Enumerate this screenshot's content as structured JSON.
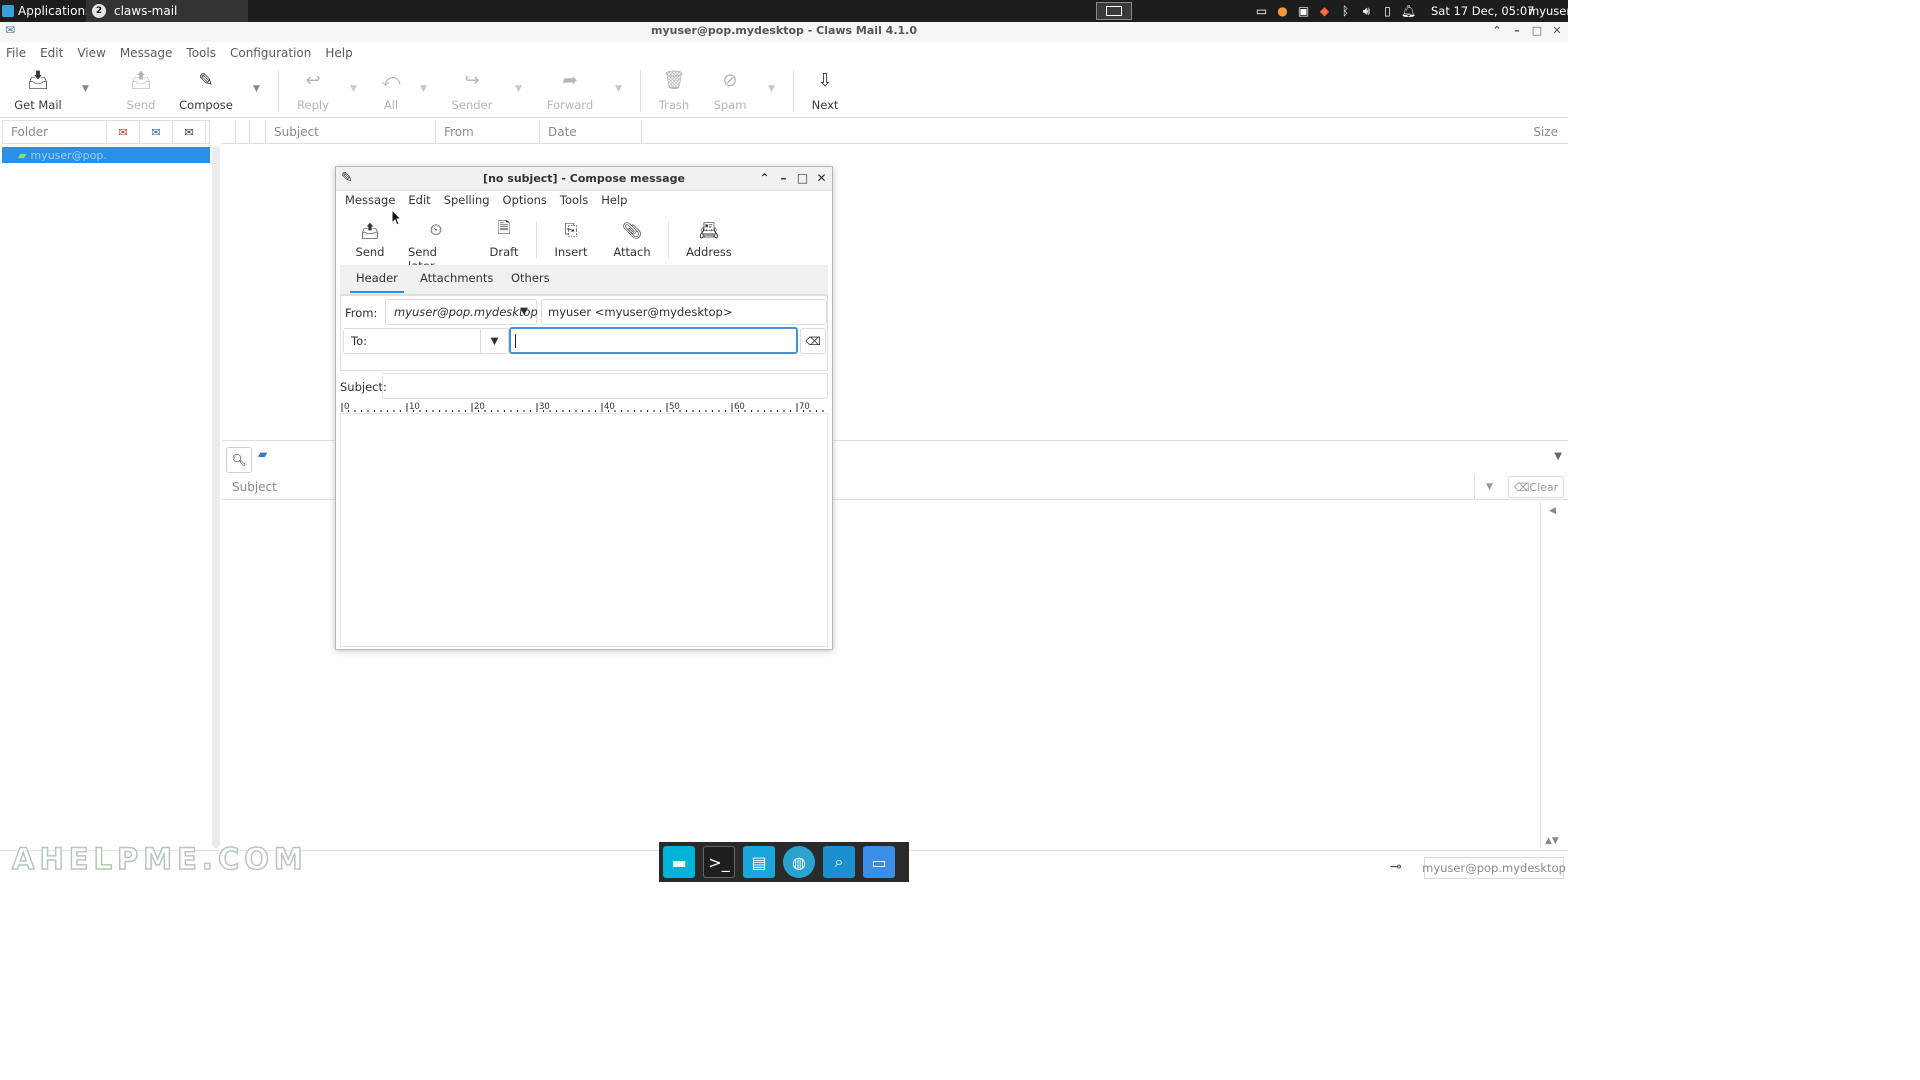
{
  "top_panel": {
    "applications_label": "Applications :",
    "task_label": "claws-mail",
    "task_badge": "2",
    "clock": "Sat 17 Dec, 05:07",
    "user": "myuser"
  },
  "window": {
    "title": "myuser@pop.mydesktop - Claws Mail 4.1.0"
  },
  "menubar": {
    "items": [
      "File",
      "Edit",
      "View",
      "Message",
      "Tools",
      "Configuration",
      "Help"
    ]
  },
  "toolbar": {
    "get_mail": "Get Mail",
    "send": "Send",
    "compose": "Compose",
    "reply": "Reply",
    "all": "All",
    "sender": "Sender",
    "forward": "Forward",
    "trash": "Trash",
    "spam": "Spam",
    "next": "Next"
  },
  "folder_pane": {
    "header": "Folder",
    "selected_folder": "myuser@pop."
  },
  "message_list": {
    "columns": [
      "Subject",
      "From",
      "Date",
      "Size"
    ]
  },
  "search": {
    "subject_label": "Subject",
    "clear_label": "Clear"
  },
  "statusbar": {
    "account": "myuser@pop.mydesktop"
  },
  "watermark": "AHELPME.COM",
  "compose": {
    "title": "[no subject] - Compose message",
    "menu": [
      "Message",
      "Edit",
      "Spelling",
      "Options",
      "Tools",
      "Help"
    ],
    "toolbar": {
      "send": "Send",
      "send_later": "Send later",
      "draft": "Draft",
      "insert": "Insert",
      "attach": "Attach",
      "address": "Address"
    },
    "tabs": [
      "Header",
      "Attachments",
      "Others"
    ],
    "active_tab": "Header",
    "from_label": "From:",
    "from_account": "myuser@pop.mydesktop",
    "from_address": "myuser <myuser@mydesktop>",
    "to_label": "To:",
    "to_value": "",
    "subject_label": "Subject:",
    "subject_value": "",
    "ruler_marks": [
      "0",
      "10",
      "20",
      "30",
      "40",
      "50",
      "60",
      "70"
    ]
  },
  "colors": {
    "accent": "#2a8fe6",
    "panel_bg": "#1d1d1d",
    "focus_border": "#4a90d9"
  }
}
